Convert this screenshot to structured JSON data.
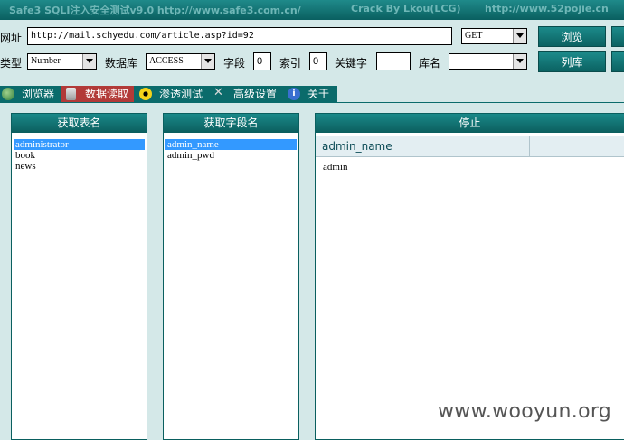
{
  "window": {
    "title_parts": [
      "Safe3 SQLI注入安全测试v9.0 http://www.safe3.com.cn/",
      "Crack By Lkou(LCG)",
      "http://www.52pojie.cn"
    ]
  },
  "toolbar": {
    "url_label": "网址",
    "url_value": "http://mail.schyedu.com/article.asp?id=92",
    "method_value": "GET",
    "browse_label": "浏览",
    "type_label": "类型",
    "type_value": "Number",
    "db_label": "数据库",
    "db_value": "ACCESS",
    "field_label": "字段",
    "field_value": "0",
    "index_label": "索引",
    "index_value": "0",
    "keyword_label": "关键字",
    "keyword_value": "",
    "dbname_label": "库名",
    "dbname_value": "",
    "listdb_label": "列库"
  },
  "tabs": [
    {
      "label": "浏览器",
      "icon": "globe-icon",
      "active": false
    },
    {
      "label": "数据读取",
      "icon": "database-icon",
      "active": true
    },
    {
      "label": "渗透测试",
      "icon": "radiation-icon",
      "active": false
    },
    {
      "label": "高级设置",
      "icon": "tools-icon",
      "active": false
    },
    {
      "label": "关于",
      "icon": "info-icon",
      "active": false
    }
  ],
  "panels": {
    "tables": {
      "header": "获取表名",
      "items": [
        "administrator",
        "book",
        "news"
      ],
      "selected": 0
    },
    "fields": {
      "header": "获取字段名",
      "items": [
        "admin_name",
        "admin_pwd"
      ],
      "selected": 0
    },
    "results": {
      "header": "停止",
      "columns": [
        "admin_name"
      ],
      "rows": [
        [
          "admin"
        ]
      ]
    }
  },
  "watermark": "www.wooyun.org",
  "colors": {
    "teal": "#0b6262",
    "active_tab": "#b23a38",
    "selection": "#3399ff",
    "background": "#d4e8e8"
  }
}
